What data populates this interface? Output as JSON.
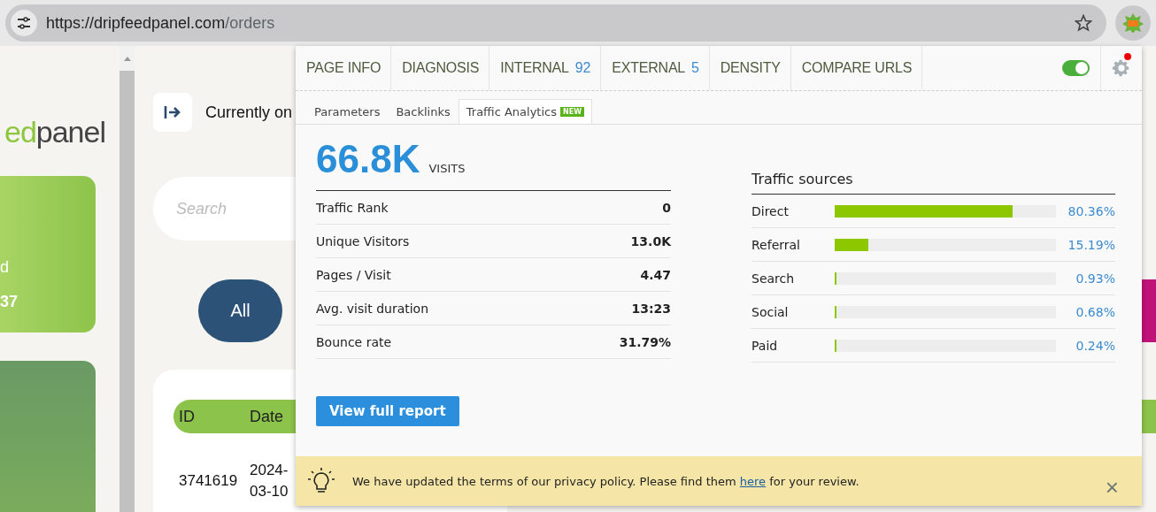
{
  "browser": {
    "url_host": "https://dripfeedpanel.com",
    "url_path": "/orders"
  },
  "page": {
    "logo_green": "ed",
    "logo_grey": "panel",
    "card_line_1": "d",
    "card_line_2": "37",
    "currently_on": "Currently on",
    "search": {
      "placeholder": "Search"
    },
    "filter_all": "All",
    "table": {
      "columns": [
        "ID",
        "Date"
      ],
      "rows": [
        {
          "id": "3741619",
          "date": "2024-\n03-10"
        }
      ]
    }
  },
  "popup": {
    "tabs": [
      {
        "label": "PAGE INFO",
        "selected": false
      },
      {
        "label": "DIAGNOSIS",
        "selected": false
      },
      {
        "label": "INTERNAL",
        "count": "92",
        "selected": false
      },
      {
        "label": "EXTERNAL",
        "count": "5",
        "selected": false
      },
      {
        "label": "DENSITY",
        "selected": false
      },
      {
        "label": "COMPARE URLS",
        "selected": false
      }
    ],
    "enabled": true,
    "settings_notification": true,
    "subtabs": [
      {
        "label": "Parameters",
        "selected": false
      },
      {
        "label": "Backlinks",
        "selected": false
      },
      {
        "label": "Traffic Analytics",
        "badge": "NEW",
        "selected": true
      }
    ],
    "visits": "66.8K",
    "visits_label": "VISITS",
    "stats": [
      {
        "label": "Traffic Rank",
        "value": "0"
      },
      {
        "label": "Unique Visitors",
        "value": "13.0K"
      },
      {
        "label": "Pages / Visit",
        "value": "4.47"
      },
      {
        "label": "Avg. visit duration",
        "value": "13:23"
      },
      {
        "label": "Bounce rate",
        "value": "31.79%"
      }
    ],
    "sources_title": "Traffic sources",
    "sources": [
      {
        "name": "Direct",
        "level": 0.8036,
        "reading": "80.36%"
      },
      {
        "name": "Referral",
        "level": 0.1519,
        "reading": "15.19%"
      },
      {
        "name": "Search",
        "level": 0.0093,
        "reading": "0.93%"
      },
      {
        "name": "Social",
        "level": 0.0068,
        "reading": "0.68%"
      },
      {
        "name": "Paid",
        "level": 0.0024,
        "reading": "0.24%"
      }
    ],
    "report_button": "View full report",
    "notice": {
      "text_before": "We have updated the terms of our privacy policy. Please find them ",
      "link": "here",
      "text_after": " for your review.",
      "close": "×"
    }
  }
}
